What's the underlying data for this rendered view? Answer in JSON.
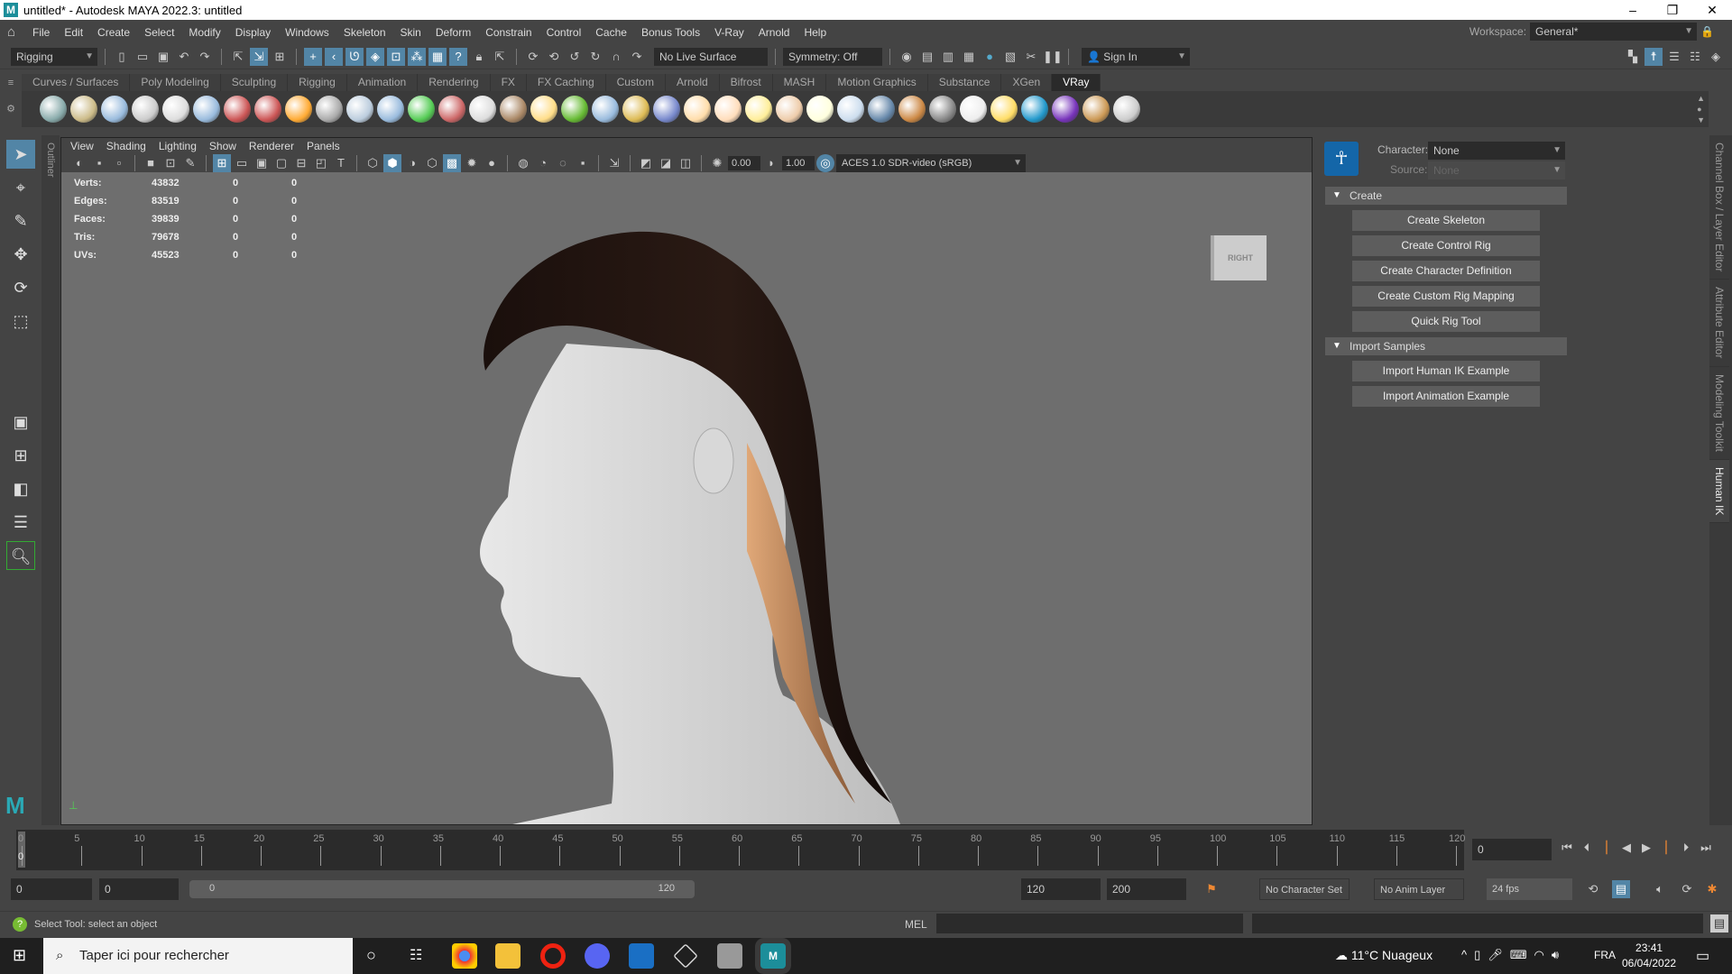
{
  "title": "untitled* - Autodesk MAYA 2022.3: untitled",
  "menu": [
    "File",
    "Edit",
    "Create",
    "Select",
    "Modify",
    "Display",
    "Windows",
    "Skeleton",
    "Skin",
    "Deform",
    "Constrain",
    "Control",
    "Cache",
    "Bonus Tools",
    "V-Ray",
    "Arnold",
    "Help"
  ],
  "workspace": {
    "label": "Workspace:",
    "value": "General*"
  },
  "statusline": {
    "menuset": "Rigging",
    "live_surface": "No Live Surface",
    "symmetry": "Symmetry: Off",
    "sign_in": "Sign In"
  },
  "shelf_tabs": [
    "Curves / Surfaces",
    "Poly Modeling",
    "Sculpting",
    "Rigging",
    "Animation",
    "Rendering",
    "FX",
    "FX Caching",
    "Custom",
    "Arnold",
    "Bifrost",
    "MASH",
    "Motion Graphics",
    "Substance",
    "XGen",
    "VRay"
  ],
  "active_shelf": "VRay",
  "shelf_icon_colors": [
    "#8aa",
    "#cb8",
    "#9bd",
    "#ccc",
    "#ddd",
    "#9bd",
    "#c55",
    "#c55",
    "#fa3",
    "#aaa",
    "#bcd",
    "#9bd",
    "#5c5",
    "#c66",
    "#ddd",
    "#a86",
    "#fd8",
    "#6b3",
    "#9bd",
    "#db5",
    "#78c",
    "#fda",
    "#fdb",
    "#fe9",
    "#eca",
    "#ffd",
    "#cde",
    "#68a",
    "#c84",
    "#888",
    "#eee",
    "#fd6",
    "#29c",
    "#73b",
    "#c95",
    "#ccc"
  ],
  "outliner_label": "Outliner",
  "panel_menu": [
    "View",
    "Shading",
    "Lighting",
    "Show",
    "Renderer",
    "Panels"
  ],
  "panel_toolbar": {
    "exposure": "0.00",
    "gamma": "1.00",
    "colorspace": "ACES 1.0 SDR-video (sRGB)"
  },
  "hud": [
    {
      "label": "Verts:",
      "v1": "43832",
      "v2": "0",
      "v3": "0"
    },
    {
      "label": "Edges:",
      "v1": "83519",
      "v2": "0",
      "v3": "0"
    },
    {
      "label": "Faces:",
      "v1": "39839",
      "v2": "0",
      "v3": "0"
    },
    {
      "label": "Tris:",
      "v1": "79678",
      "v2": "0",
      "v3": "0"
    },
    {
      "label": "UVs:",
      "v1": "45523",
      "v2": "0",
      "v3": "0"
    }
  ],
  "viewcube": "RIGHT",
  "hik": {
    "character_label": "Character:",
    "character_value": "None",
    "source_label": "Source:",
    "source_value": "None",
    "create_section": "Create",
    "create_buttons": [
      "Create Skeleton",
      "Create Control Rig",
      "Create Character Definition",
      "Create Custom Rig Mapping",
      "Quick Rig Tool"
    ],
    "import_section": "Import Samples",
    "import_buttons": [
      "Import Human IK Example",
      "Import Animation Example"
    ]
  },
  "side_tabs": [
    "Channel Box / Layer Editor",
    "Attribute Editor",
    "Modeling Toolkit",
    "Human IK"
  ],
  "timeline": {
    "ticks": [
      "0",
      "5",
      "10",
      "15",
      "20",
      "25",
      "30",
      "35",
      "40",
      "45",
      "50",
      "55",
      "60",
      "65",
      "70",
      "75",
      "80",
      "85",
      "90",
      "95",
      "100",
      "105",
      "110",
      "115",
      "120"
    ],
    "current_frame": "0",
    "current_field": "0"
  },
  "range": {
    "start": "0",
    "inner_start": "0",
    "slider_start": "0",
    "slider_end": "120",
    "inner_end": "120",
    "end": "200",
    "character_set": "No Character Set",
    "anim_layer": "No Anim Layer",
    "fps": "24 fps"
  },
  "cmdline": {
    "help": "Select Tool: select an object",
    "lang": "MEL"
  },
  "taskbar": {
    "search": "Taper ici pour rechercher",
    "weather": "11°C  Nuageux",
    "lang": "FRA",
    "time": "23:41",
    "date": "06/04/2022"
  }
}
